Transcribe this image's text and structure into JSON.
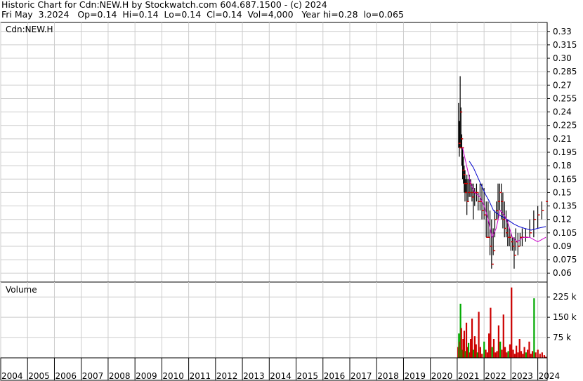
{
  "header": {
    "line1": "Historic Chart for Cdn:NEW.H by Stockwatch.com 604.687.1500 - (c) 2024",
    "line2": "Fri May  3.2024   Op=0.14  Hi=0.14  Lo=0.14  Cl=0.14  Vol=4,000   Year hi=0.28  lo=0.065"
  },
  "chart_data": [
    {
      "type": "ohlc",
      "title": "Cdn:NEW.H",
      "price_ticks": [
        "0.33",
        "0.315",
        "0.30",
        "0.285",
        "0.27",
        "0.255",
        "0.24",
        "0.225",
        "0.21",
        "0.195",
        "0.18",
        "0.165",
        "0.15",
        "0.135",
        "0.12",
        "0.105",
        "0.09",
        "0.075",
        "0.06"
      ],
      "ylim": [
        0.05,
        0.34
      ],
      "x_ticks": [
        "2004",
        "2005",
        "2006",
        "2007",
        "2008",
        "2009",
        "2010",
        "2011",
        "2012",
        "2013",
        "2014",
        "2015",
        "2016",
        "2017",
        "2018",
        "2019",
        "2020",
        "2021",
        "2022",
        "2023",
        "2024"
      ],
      "xlim": [
        2004.0,
        2024.35
      ],
      "grid": true,
      "colors": {
        "bars": "#000000",
        "closes": "#cc0000",
        "ma_long": "#0000cc",
        "ma_short": "#cc00cc"
      },
      "price_bars": [
        [
          2021.05,
          0.25,
          0.2,
          0.205
        ],
        [
          2021.08,
          0.23,
          0.19,
          0.2
        ],
        [
          2021.11,
          0.28,
          0.2,
          0.24
        ],
        [
          2021.14,
          0.245,
          0.2,
          0.21
        ],
        [
          2021.17,
          0.215,
          0.18,
          0.2
        ],
        [
          2021.2,
          0.2,
          0.165,
          0.175
        ],
        [
          2021.23,
          0.19,
          0.16,
          0.17
        ],
        [
          2021.26,
          0.18,
          0.15,
          0.16
        ],
        [
          2021.29,
          0.175,
          0.14,
          0.15
        ],
        [
          2021.32,
          0.165,
          0.15,
          0.16
        ],
        [
          2021.36,
          0.17,
          0.125,
          0.14
        ],
        [
          2021.4,
          0.165,
          0.14,
          0.15
        ],
        [
          2021.45,
          0.17,
          0.145,
          0.16
        ],
        [
          2021.5,
          0.165,
          0.145,
          0.15
        ],
        [
          2021.55,
          0.16,
          0.14,
          0.145
        ],
        [
          2021.6,
          0.16,
          0.12,
          0.15
        ],
        [
          2021.65,
          0.155,
          0.135,
          0.15
        ],
        [
          2021.72,
          0.16,
          0.14,
          0.15
        ],
        [
          2021.78,
          0.15,
          0.13,
          0.14
        ],
        [
          2021.85,
          0.16,
          0.13,
          0.14
        ],
        [
          2021.92,
          0.16,
          0.12,
          0.13
        ],
        [
          2022.0,
          0.155,
          0.12,
          0.125
        ],
        [
          2022.08,
          0.14,
          0.1,
          0.1
        ],
        [
          2022.15,
          0.14,
          0.1,
          0.1
        ],
        [
          2022.22,
          0.13,
          0.08,
          0.09
        ],
        [
          2022.28,
          0.12,
          0.065,
          0.07
        ],
        [
          2022.34,
          0.11,
          0.08,
          0.085
        ],
        [
          2022.4,
          0.13,
          0.1,
          0.12
        ],
        [
          2022.46,
          0.14,
          0.12,
          0.13
        ],
        [
          2022.52,
          0.16,
          0.12,
          0.14
        ],
        [
          2022.58,
          0.16,
          0.13,
          0.15
        ],
        [
          2022.64,
          0.16,
          0.12,
          0.14
        ],
        [
          2022.7,
          0.15,
          0.11,
          0.12
        ],
        [
          2022.76,
          0.14,
          0.1,
          0.11
        ],
        [
          2022.82,
          0.13,
          0.1,
          0.105
        ],
        [
          2022.88,
          0.12,
          0.09,
          0.1
        ],
        [
          2022.94,
          0.11,
          0.09,
          0.1
        ],
        [
          2023.0,
          0.105,
          0.085,
          0.095
        ],
        [
          2023.06,
          0.1,
          0.085,
          0.09
        ],
        [
          2023.12,
          0.1,
          0.065,
          0.08
        ],
        [
          2023.18,
          0.11,
          0.085,
          0.095
        ],
        [
          2023.26,
          0.105,
          0.08,
          0.09
        ],
        [
          2023.34,
          0.105,
          0.09,
          0.1
        ],
        [
          2023.42,
          0.11,
          0.09,
          0.1
        ],
        [
          2023.55,
          0.11,
          0.095,
          0.1
        ],
        [
          2023.7,
          0.12,
          0.1,
          0.105
        ],
        [
          2023.85,
          0.13,
          0.1,
          0.12
        ],
        [
          2024.0,
          0.135,
          0.11,
          0.125
        ],
        [
          2024.15,
          0.14,
          0.12,
          0.13
        ],
        [
          2024.3,
          0.14,
          0.14,
          0.14
        ]
      ],
      "moving_average_long": [
        [
          2021.45,
          0.185
        ],
        [
          2021.6,
          0.178
        ],
        [
          2021.75,
          0.168
        ],
        [
          2021.9,
          0.158
        ],
        [
          2022.05,
          0.148
        ],
        [
          2022.2,
          0.14
        ],
        [
          2022.35,
          0.13
        ],
        [
          2022.55,
          0.125
        ],
        [
          2022.75,
          0.122
        ],
        [
          2022.95,
          0.118
        ],
        [
          2023.1,
          0.115
        ],
        [
          2023.3,
          0.112
        ],
        [
          2023.5,
          0.11
        ],
        [
          2023.75,
          0.108
        ],
        [
          2024.0,
          0.11
        ],
        [
          2024.3,
          0.112
        ]
      ],
      "moving_average_short": [
        [
          2021.2,
          0.2
        ],
        [
          2021.35,
          0.18
        ],
        [
          2021.5,
          0.16
        ],
        [
          2021.65,
          0.15
        ],
        [
          2021.85,
          0.145
        ],
        [
          2022.0,
          0.135
        ],
        [
          2022.15,
          0.12
        ],
        [
          2022.3,
          0.1
        ],
        [
          2022.45,
          0.11
        ],
        [
          2022.6,
          0.13
        ],
        [
          2022.75,
          0.125
        ],
        [
          2022.9,
          0.115
        ],
        [
          2023.05,
          0.1
        ],
        [
          2023.25,
          0.095
        ],
        [
          2023.45,
          0.1
        ],
        [
          2023.7,
          0.1
        ],
        [
          2024.0,
          0.095
        ],
        [
          2024.3,
          0.1
        ]
      ]
    },
    {
      "type": "bar",
      "title": "Volume",
      "volume_ticks": [
        "225 k",
        "150 k",
        "75 k"
      ],
      "ylim": [
        0,
        280000
      ],
      "colors": {
        "volume": "#cc0000",
        "volume_alt": "#00aa00"
      },
      "volume_bars": [
        [
          2021.03,
          40000,
          "#cc0000"
        ],
        [
          2021.06,
          90000,
          "#00aa00"
        ],
        [
          2021.09,
          60000,
          "#cc0000"
        ],
        [
          2021.12,
          200000,
          "#00aa00"
        ],
        [
          2021.15,
          110000,
          "#cc0000"
        ],
        [
          2021.18,
          30000,
          "#00aa00"
        ],
        [
          2021.22,
          70000,
          "#cc0000"
        ],
        [
          2021.26,
          100000,
          "#cc0000"
        ],
        [
          2021.3,
          25000,
          "#00aa00"
        ],
        [
          2021.34,
          130000,
          "#cc0000"
        ],
        [
          2021.38,
          40000,
          "#cc0000"
        ],
        [
          2021.42,
          55000,
          "#00aa00"
        ],
        [
          2021.46,
          20000,
          "#cc0000"
        ],
        [
          2021.5,
          70000,
          "#cc0000"
        ],
        [
          2021.55,
          145000,
          "#cc0000"
        ],
        [
          2021.6,
          30000,
          "#00aa00"
        ],
        [
          2021.65,
          80000,
          "#cc0000"
        ],
        [
          2021.7,
          50000,
          "#cc0000"
        ],
        [
          2021.75,
          20000,
          "#00aa00"
        ],
        [
          2021.8,
          170000,
          "#cc0000"
        ],
        [
          2021.86,
          40000,
          "#cc0000"
        ],
        [
          2021.92,
          15000,
          "#cc0000"
        ],
        [
          2022.0,
          60000,
          "#00aa00"
        ],
        [
          2022.06,
          30000,
          "#cc0000"
        ],
        [
          2022.12,
          20000,
          "#cc0000"
        ],
        [
          2022.18,
          90000,
          "#cc0000"
        ],
        [
          2022.24,
          185000,
          "#cc0000"
        ],
        [
          2022.3,
          40000,
          "#00aa00"
        ],
        [
          2022.36,
          70000,
          "#cc0000"
        ],
        [
          2022.42,
          20000,
          "#cc0000"
        ],
        [
          2022.48,
          25000,
          "#cc0000"
        ],
        [
          2022.54,
          120000,
          "#cc0000"
        ],
        [
          2022.6,
          60000,
          "#00aa00"
        ],
        [
          2022.66,
          30000,
          "#cc0000"
        ],
        [
          2022.72,
          160000,
          "#cc0000"
        ],
        [
          2022.78,
          40000,
          "#cc0000"
        ],
        [
          2022.84,
          20000,
          "#cc0000"
        ],
        [
          2022.9,
          25000,
          "#00aa00"
        ],
        [
          2022.96,
          50000,
          "#cc0000"
        ],
        [
          2023.02,
          260000,
          "#cc0000"
        ],
        [
          2023.08,
          30000,
          "#cc0000"
        ],
        [
          2023.14,
          15000,
          "#cc0000"
        ],
        [
          2023.2,
          45000,
          "#cc0000"
        ],
        [
          2023.26,
          20000,
          "#cc0000"
        ],
        [
          2023.32,
          70000,
          "#cc0000"
        ],
        [
          2023.38,
          25000,
          "#cc0000"
        ],
        [
          2023.44,
          15000,
          "#cc0000"
        ],
        [
          2023.5,
          40000,
          "#cc0000"
        ],
        [
          2023.56,
          20000,
          "#00aa00"
        ],
        [
          2023.62,
          30000,
          "#cc0000"
        ],
        [
          2023.68,
          60000,
          "#cc0000"
        ],
        [
          2023.74,
          15000,
          "#cc0000"
        ],
        [
          2023.8,
          25000,
          "#cc0000"
        ],
        [
          2023.86,
          220000,
          "#00aa00"
        ],
        [
          2023.92,
          20000,
          "#cc0000"
        ],
        [
          2024.0,
          30000,
          "#cc0000"
        ],
        [
          2024.08,
          15000,
          "#cc0000"
        ],
        [
          2024.16,
          20000,
          "#cc0000"
        ],
        [
          2024.24,
          10000,
          "#cc0000"
        ],
        [
          2024.3,
          4000,
          "#cc0000"
        ]
      ]
    }
  ]
}
